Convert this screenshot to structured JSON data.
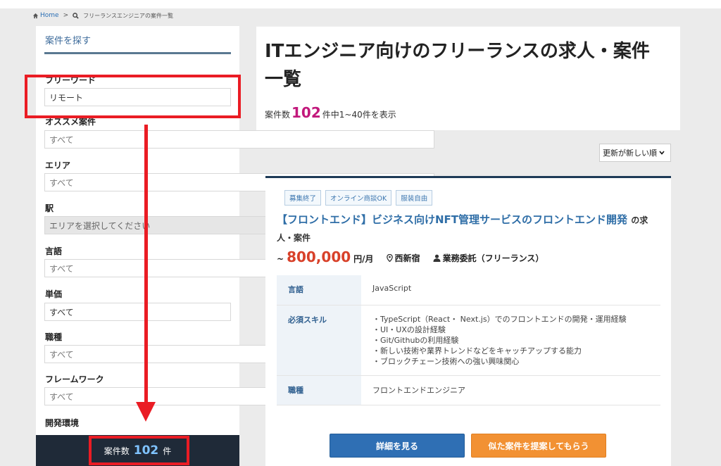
{
  "breadcrumb": {
    "home": "Home",
    "separator": ">",
    "current": "フリーランスエンジニアの案件一覧"
  },
  "sidebar": {
    "title": "案件を探す",
    "fields": [
      {
        "label": "フリーワード",
        "value": "リモート"
      },
      {
        "label": "オススメ案件",
        "value": "すべて"
      },
      {
        "label": "エリア",
        "value": "すべて"
      },
      {
        "label": "駅",
        "value": "エリアを選択してください"
      },
      {
        "label": "言語",
        "value": "すべて"
      },
      {
        "label": "単価",
        "value": "すべて"
      },
      {
        "label": "職種",
        "value": "すべて"
      },
      {
        "label": "フレームワーク",
        "value": "すべて"
      },
      {
        "label": "開発環境",
        "value": ""
      }
    ],
    "footer": {
      "prefix": "案件数",
      "count": "102",
      "suffix": "件"
    }
  },
  "main": {
    "title": "ITエンジニア向けのフリーランスの求人・案件一覧",
    "count_prefix": "案件数",
    "count": "102",
    "count_suffix": "件中1~40件を表示",
    "sort": "更新が新しい順"
  },
  "card": {
    "tags": [
      "募集終了",
      "オンライン商談OK",
      "服装自由"
    ],
    "title": "【フロントエンド】ビジネス向けNFT管理サービスのフロントエンド開発",
    "title_suffix": "の求人・案件",
    "price_prefix": "~",
    "price": "800,000",
    "price_unit": "円/月",
    "location": "西新宿",
    "contract": "業務委託（フリーランス）",
    "specs": {
      "language_key": "言語",
      "language_value": "JavaScript",
      "skills_key": "必須スキル",
      "skills": [
        "・TypeScript（React・ Next.js）でのフロントエンドの開発・運用経験",
        "・UI・UXの設計経験",
        "・Git/Githubの利用経験",
        "・新しい技術や業界トレンドなどをキャッチアップする能力",
        "・ブロックチェーン技術への強い興味関心"
      ],
      "job_key": "職種",
      "job_value": "フロントエンドエンジニア"
    },
    "detail_button": "詳細を見る",
    "suggest_button": "似た案件を提案してもらう"
  },
  "colors": {
    "accent": "#2f6ea7",
    "price": "#d8412a",
    "count": "#c2187c",
    "annotation": "#ea1c24",
    "suggest": "#f29133"
  }
}
